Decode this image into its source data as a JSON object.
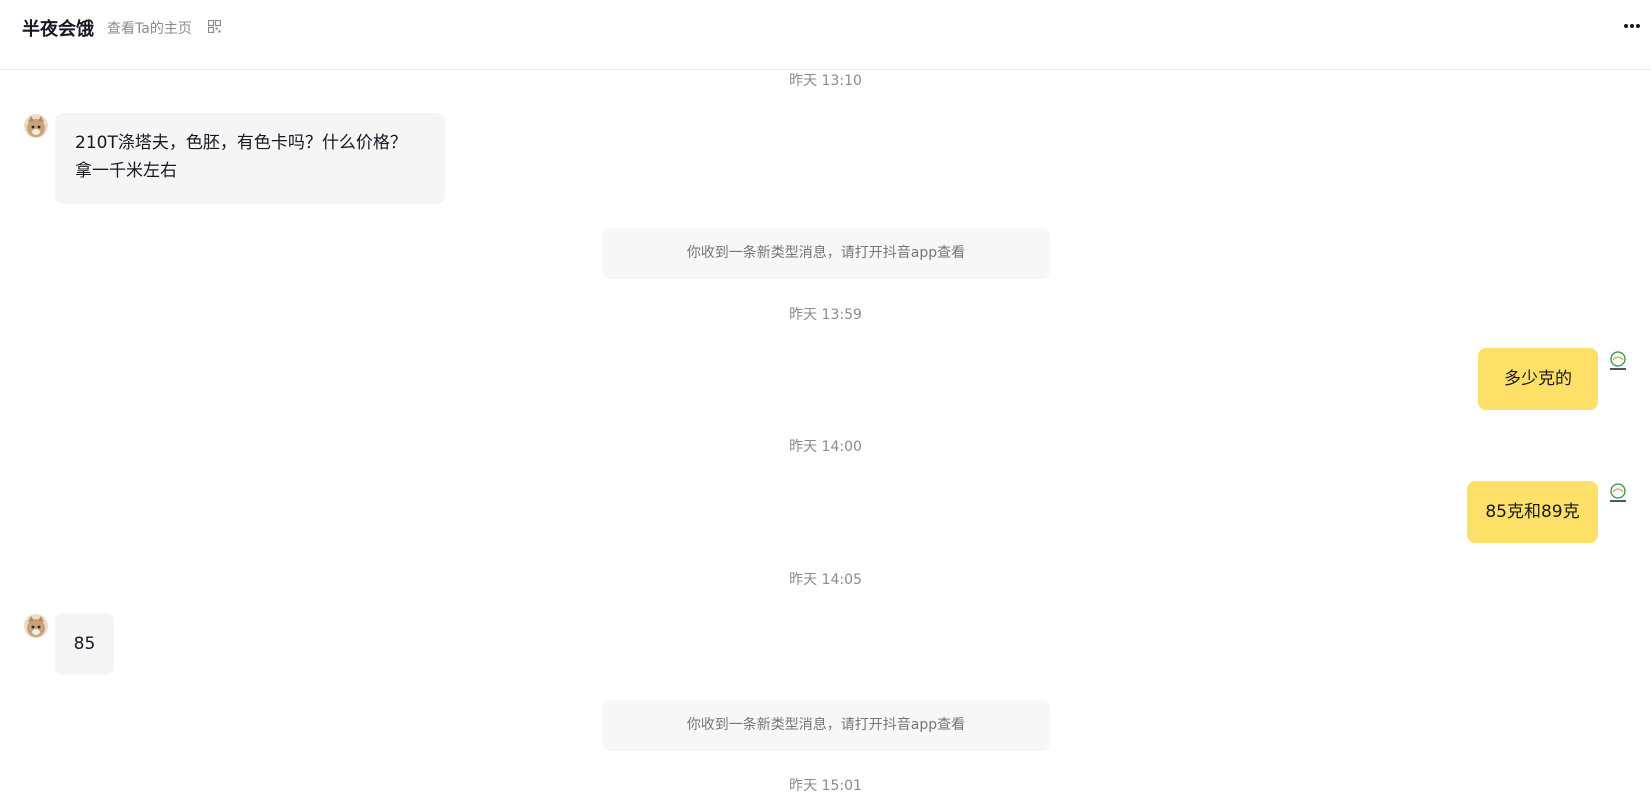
{
  "header": {
    "title": "半夜会饿",
    "homepage_link": "查看Ta的主页"
  },
  "messages": {
    "t1": "昨天 13:10",
    "m1_line1": "210T涤塔夫，色胚，有色卡吗？什么价格？",
    "m1_line2": "拿一千米左右",
    "sys1": "你收到一条新类型消息，请打开抖音app查看",
    "t2": "昨天 13:59",
    "m2": "多少克的",
    "t3": "昨天 14:00",
    "m3": "85克和89克",
    "t4": "昨天 14:05",
    "m4": "85",
    "sys2": "你收到一条新类型消息，请打开抖音app查看",
    "t5": "昨天 15:01"
  },
  "colors": {
    "incoming_bubble": "#f5f5f5",
    "outgoing_bubble": "#fde068",
    "system_notice": "#f7f7f7"
  },
  "icons": {
    "qr": "qr-code-icon",
    "more": "more-icon",
    "peer_avatar": "cat-avatar",
    "self_avatar": "store-logo-avatar"
  }
}
